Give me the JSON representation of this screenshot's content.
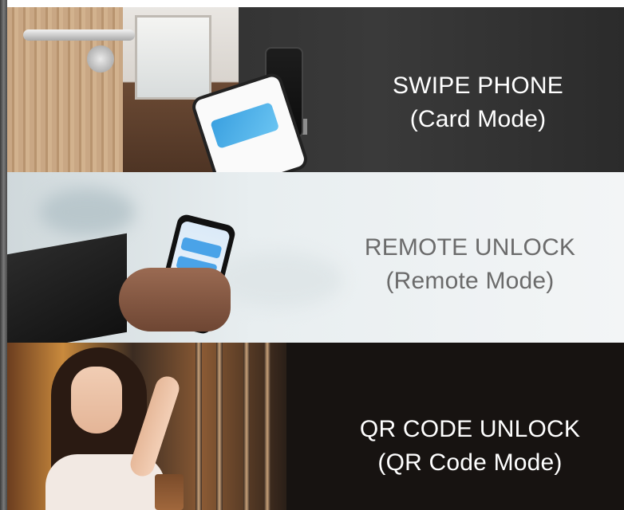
{
  "panels": [
    {
      "line1": "SWIPE PHONE",
      "line2": "(Card Mode)"
    },
    {
      "line1": "REMOTE UNLOCK",
      "line2": "(Remote Mode)"
    },
    {
      "line1": "QR CODE UNLOCK",
      "line2": "(QR Code Mode)"
    }
  ],
  "colors": {
    "panel_dark": "#2b2b2b",
    "panel_light": "#eef2f3",
    "panel_black": "#171311",
    "caption_light": "#ffffff",
    "caption_gray": "#6b6b6b"
  }
}
